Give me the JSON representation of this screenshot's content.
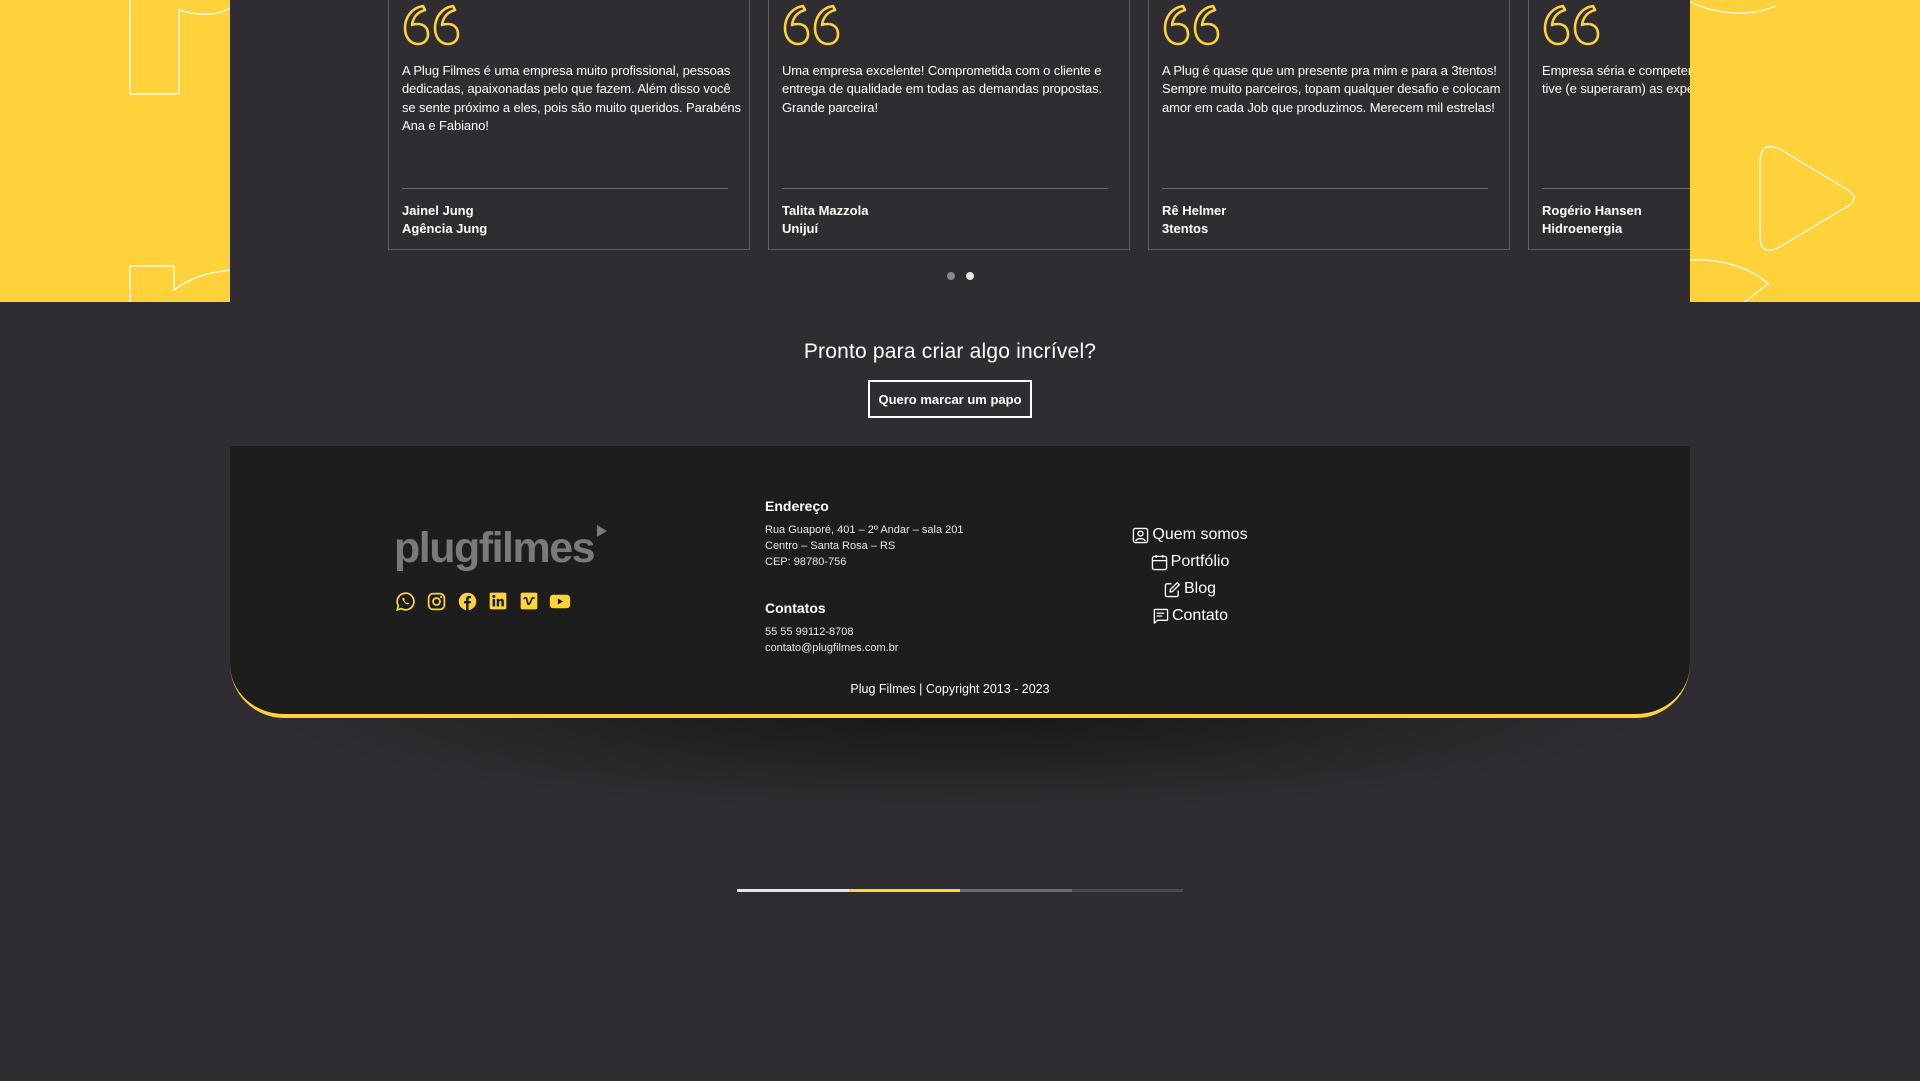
{
  "colors": {
    "accent": "#fdd23a",
    "background": "#2f2d31",
    "footer": "#1d1d1d"
  },
  "testimonials": [
    {
      "text": "A Plug Filmes é uma empresa muito profissional, pessoas dedicadas, apaixonadas pelo que fazem. Além disso você se sente próximo a eles, pois são muito queridos. Parabéns Ana e Fabiano!",
      "name": "Jainel Jung",
      "company": "Agência Jung"
    },
    {
      "text": "Uma empresa excelente! Comprometida com o cliente e entrega de qualidade em todas as demandas propostas. Grande parceira!",
      "name": "Talita Mazzola",
      "company": "Unijuí"
    },
    {
      "text": "A Plug é quase que um presente pra mim e para a 3tentos! Sempre muito parceiros, topam qualquer desafio e colocam amor em cada Job que produzimos. Merecem mil estrelas!",
      "name": "Rê Helmer",
      "company": "3tentos"
    },
    {
      "text": "Empresa séria e competente. Todas as experiências que tive (e superaram) as expectativas.",
      "name": "Rogério Hansen",
      "company": "Hidroenergia"
    }
  ],
  "carousel": {
    "page_count": 2,
    "active_index": 1
  },
  "cta": {
    "title": "Pronto para criar algo incrível?",
    "button_label": "Quero marcar um papo"
  },
  "footer": {
    "logo_text": "plugfilmes",
    "socials": [
      "whatsapp-icon",
      "instagram-icon",
      "facebook-icon",
      "linkedin-icon",
      "vimeo-icon",
      "youtube-icon"
    ],
    "address_title": "Endereço",
    "address_lines": [
      "Rua Guaporé, 401 – 2º Andar – sala 201",
      "Centro – Santa Rosa – RS",
      "CEP: 98780-756"
    ],
    "contacts_title": "Contatos",
    "phone": "55 55 99112-8708",
    "email": "contato@plugfilmes.com.br",
    "nav": [
      {
        "label": "Quem somos",
        "icon": "person-icon"
      },
      {
        "label": "Portfólio",
        "icon": "calendar-icon"
      },
      {
        "label": "Blog",
        "icon": "edit-icon"
      },
      {
        "label": "Contato",
        "icon": "chat-icon"
      }
    ],
    "copyright": "Plug Filmes | Copyright 2013 - 2023"
  },
  "progress": {
    "segment_colors": [
      "#e6e6e6",
      "#fdd23a",
      "#6b6a6d",
      "#4a494c"
    ]
  }
}
